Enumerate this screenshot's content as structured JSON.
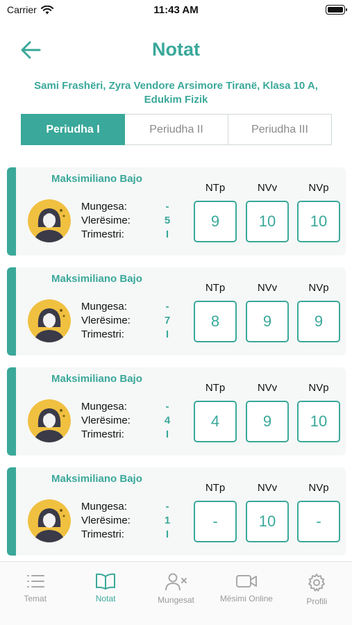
{
  "status_bar": {
    "carrier": "Carrier",
    "time": "11:43 AM"
  },
  "header": {
    "title": "Notat",
    "back_icon": "arrow-left-icon"
  },
  "subtitle": "Sami Frashëri, Zyra Vendore Arsimore Tiranë, Klasa 10 A, Edukim Fizik",
  "tabs": [
    {
      "label": "Periudha I",
      "active": true
    },
    {
      "label": "Periudha II",
      "active": false
    },
    {
      "label": "Periudha III",
      "active": false
    }
  ],
  "labels": {
    "mungesa": "Mungesa:",
    "vleresime": "Vlerësime:",
    "trimestri": "Trimestri:"
  },
  "grade_headers": [
    "NTp",
    "NVv",
    "NVp"
  ],
  "students": [
    {
      "name": "Maksimiliano Bajo",
      "mungesa": "-",
      "vleresime": "5",
      "trimestri": "I",
      "grades": [
        "9",
        "10",
        "10"
      ]
    },
    {
      "name": "Maksimiliano Bajo",
      "mungesa": "-",
      "vleresime": "7",
      "trimestri": "I",
      "grades": [
        "8",
        "9",
        "9"
      ]
    },
    {
      "name": "Maksimiliano Bajo",
      "mungesa": "-",
      "vleresime": "4",
      "trimestri": "I",
      "grades": [
        "4",
        "9",
        "10"
      ]
    },
    {
      "name": "Maksimiliano Bajo",
      "mungesa": "-",
      "vleresime": "1",
      "trimestri": "I",
      "grades": [
        "-",
        "10",
        "-"
      ]
    }
  ],
  "tabbar": [
    {
      "label": "Temat",
      "icon": "list-icon",
      "active": false
    },
    {
      "label": "Notat",
      "icon": "book-icon",
      "active": true
    },
    {
      "label": "Mungesat",
      "icon": "user-x-icon",
      "active": false
    },
    {
      "label": "Mësimi Online",
      "icon": "video-icon",
      "active": false
    },
    {
      "label": "Profili",
      "icon": "gear-icon",
      "active": false
    }
  ],
  "colors": {
    "accent": "#3aa89a",
    "inactive": "#999999",
    "card_bg": "#f6f7f7"
  }
}
